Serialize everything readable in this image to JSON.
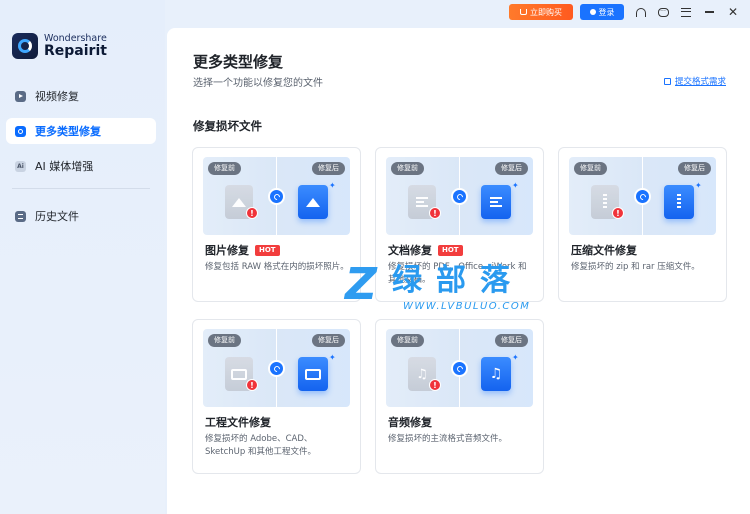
{
  "app": {
    "brand": "Wondershare",
    "product": "Repairit"
  },
  "titlebar": {
    "buy_label": "立即购买",
    "login_label": "登录",
    "icons": [
      "headset-icon",
      "feedback-icon",
      "menu-icon",
      "minimize-icon",
      "close-icon"
    ]
  },
  "sidebar": {
    "items": [
      {
        "label": "视频修复",
        "icon": "video-icon",
        "active": false
      },
      {
        "label": "更多类型修复",
        "icon": "repair-gear-icon",
        "active": true
      },
      {
        "label": "AI 媒体增强",
        "icon": "ai-icon",
        "active": false
      },
      {
        "label": "历史文件",
        "icon": "history-icon",
        "active": false
      }
    ]
  },
  "main": {
    "title": "更多类型修复",
    "subtitle": "选择一个功能以修复您的文件",
    "feedback_link": "提交格式需求",
    "section_title": "修复损坏文件",
    "before_label": "修复前",
    "after_label": "修复后",
    "cards": [
      {
        "title": "图片修复",
        "hot": "HOT",
        "desc": "修复包括 RAW 格式在内的损坏照片。",
        "icon": "image-icon"
      },
      {
        "title": "文档修复",
        "hot": "HOT",
        "desc": "修复损坏的 PDF、Office、iWork 和其他文档。",
        "icon": "document-icon"
      },
      {
        "title": "压缩文件修复",
        "hot": "",
        "desc": "修复损坏的 zip 和 rar 压缩文件。",
        "icon": "archive-icon"
      },
      {
        "title": "工程文件修复",
        "hot": "",
        "desc": "修复损坏的 Adobe、CAD、SketchUp 和其他工程文件。",
        "icon": "folder-icon"
      },
      {
        "title": "音频修复",
        "hot": "",
        "desc": "修复损坏的主流格式音频文件。",
        "icon": "audio-icon"
      }
    ]
  },
  "watermark": {
    "mark": "Z",
    "text": "绿部落",
    "url": "WWW.LVBULUO.COM"
  },
  "colors": {
    "accent": "#1a73ff",
    "buy": "#ff6a24",
    "hot": "#f23d3d",
    "sidebar_bg": "#e5eefb"
  }
}
